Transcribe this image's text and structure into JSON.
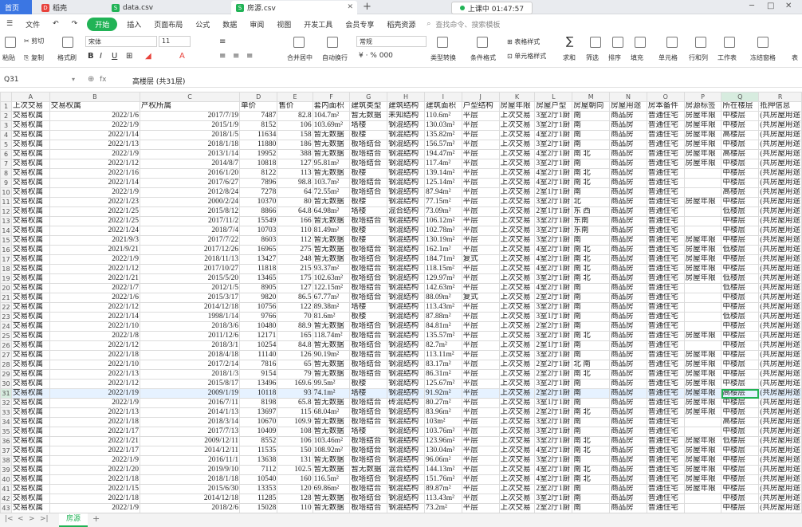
{
  "tabs": [
    {
      "label": "首页",
      "icon": "home-icon"
    },
    {
      "label": "稻壳",
      "icon": "docer-icon"
    },
    {
      "label": "data.csv",
      "icon": "spreadsheet-icon"
    },
    {
      "label": "房源.csv",
      "icon": "spreadsheet-icon"
    }
  ],
  "recording": "上课中 01:47:57",
  "menu": {
    "file": "文件",
    "items": [
      "开始",
      "插入",
      "页面布局",
      "公式",
      "数据",
      "审阅",
      "视图",
      "开发工具",
      "会员专享",
      "稻壳资源"
    ],
    "search": "查找命令、搜索模板"
  },
  "ribbon": {
    "paste": "粘贴",
    "cut": "剪切",
    "copy": "复制",
    "format_painter": "格式刷",
    "font": "宋体",
    "font_size": "11",
    "merge": "合并居中",
    "wrap": "自动换行",
    "number_format": "常规",
    "type_convert": "类型转换",
    "cond_format": "条件格式",
    "table_style": "表格样式",
    "cell_style": "单元格样式",
    "sum": "求和",
    "filter": "筛选",
    "sort": "排序",
    "fill": "填充",
    "cell": "单元格",
    "rowcol": "行和列",
    "sheet": "工作表",
    "freeze": "冻结窗格",
    "more": "表"
  },
  "formula": {
    "cell_ref": "Q31",
    "fx": "fx",
    "content": "高楼层 (共31层)"
  },
  "colors": {
    "accent": "#21b356",
    "brand": "#3b76e3"
  },
  "grid": {
    "columns": [
      "A",
      "B",
      "C",
      "D",
      "E",
      "F",
      "G",
      "H",
      "I",
      "J",
      "K",
      "L",
      "M",
      "N",
      "O",
      "P",
      "Q",
      "R"
    ],
    "header": [
      "上次交易",
      "交易权属",
      "产权所属",
      "单价",
      "售价",
      "套内面积",
      "建筑类型",
      "建筑结构",
      "建筑面积",
      "户型结构",
      "房屋年限",
      "房屋户型",
      "房屋朝向",
      "房屋用途",
      "房本备件",
      "房源标签",
      "所在楼层",
      "抵押信息"
    ],
    "rows": [
      [
        "交易权属",
        "2022/1/6",
        "2017/7/19",
        "7487",
        "82.8",
        "104.7m²",
        "暂无数据",
        "未知结构",
        "110.6m²",
        "平层",
        "上次交易",
        "3室2厅1厨",
        "南",
        "商品房",
        "普通住宅",
        "房屋年限",
        "中楼层",
        "(共房屋用途"
      ],
      [
        "交易权属",
        "2022/1/9",
        "2015/1/9",
        "8152",
        "106",
        "103.69m²",
        "塔楼",
        "钢混结构",
        "130.03m²",
        "平层",
        "上次交易",
        "3室2厅1厨",
        "南",
        "商品房",
        "普通住宅",
        "房屋年限",
        "中楼层",
        "(共房屋用途"
      ],
      [
        "交易权属",
        "2022/1/14",
        "2018/1/5",
        "11634",
        "158",
        "暂无数据",
        "板楼",
        "钢混结构",
        "135.82m²",
        "平层",
        "上次交易",
        "4室2厅1厨",
        "南",
        "商品房",
        "普通住宅",
        "房屋年限",
        "高楼层",
        "(共房屋用途"
      ],
      [
        "交易权属",
        "2022/1/13",
        "2018/1/18",
        "11880",
        "186",
        "暂无数据",
        "板塔结合",
        "钢混结构",
        "156.57m²",
        "平层",
        "上次交易",
        "3室2厅1厨",
        "南",
        "商品房",
        "普通住宅",
        "房屋年限",
        "中楼层",
        "(共房屋用途"
      ],
      [
        "交易权属",
        "2022/1/9",
        "2013/1/14",
        "19952",
        "388",
        "暂无数据",
        "板塔结合",
        "钢混结构",
        "194.47m²",
        "平层",
        "上次交易",
        "4室2厅1厨",
        "南 北",
        "商品房",
        "普通住宅",
        "房屋年限",
        "高楼层",
        "(共房屋用途"
      ],
      [
        "交易权属",
        "2022/1/12",
        "2014/8/7",
        "10818",
        "127",
        "95.81m²",
        "板塔结合",
        "钢混结构",
        "117.4m²",
        "平层",
        "上次交易",
        "3室2厅1厨",
        "南",
        "商品房",
        "普通住宅",
        "房屋年限",
        "中楼层",
        "(共房屋用途"
      ],
      [
        "交易权属",
        "2022/1/16",
        "2016/1/20",
        "8122",
        "113",
        "暂无数据",
        "板楼",
        "钢混结构",
        "139.14m²",
        "平层",
        "上次交易",
        "4室2厅1厨",
        "南 北",
        "商品房",
        "普通住宅",
        "",
        "中楼层",
        "(共房屋用途"
      ],
      [
        "交易权属",
        "2022/1/14",
        "2017/6/27",
        "7896",
        "98.8",
        "103.7m²",
        "板塔结合",
        "钢混结构",
        "125.14m²",
        "平层",
        "上次交易",
        "4室2厅1厨",
        "南 北",
        "商品房",
        "普通住宅",
        "",
        "中楼层",
        "(共房屋用途"
      ],
      [
        "交易权属",
        "2022/1/9",
        "2012/8/24",
        "7278",
        "64",
        "72.55m²",
        "板塔结合",
        "钢混结构",
        "87.94m²",
        "平层",
        "上次交易",
        "2室1厅1厨",
        "南",
        "商品房",
        "普通住宅",
        "",
        "高楼层",
        "(共房屋用途"
      ],
      [
        "交易权属",
        "2022/1/23",
        "2000/2/24",
        "10370",
        "80",
        "暂无数据",
        "板楼",
        "钢混结构",
        "77.15m²",
        "平层",
        "上次交易",
        "3室2厅1厨",
        "北",
        "商品房",
        "普通住宅",
        "房屋年限",
        "中楼层",
        "(共房屋用途"
      ],
      [
        "交易权属",
        "2022/1/25",
        "2015/8/12",
        "8866",
        "64.8",
        "64.98m²",
        "塔楼",
        "混合结构",
        "73.09m²",
        "平层",
        "上次交易",
        "2室1厅1厨",
        "东 西",
        "商品房",
        "普通住宅",
        "",
        "低楼层",
        "(共房屋用途"
      ],
      [
        "交易权属",
        "2022/1/25",
        "2017/11/2",
        "15549",
        "166",
        "暂无数据",
        "板塔结合",
        "钢混结构",
        "106.12m²",
        "平层",
        "上次交易",
        "3室2厅1厨",
        "东南",
        "商品房",
        "普通住宅",
        "",
        "中楼层",
        "(共房屋用途"
      ],
      [
        "交易权属",
        "2022/1/24",
        "2018/7/4",
        "10703",
        "110",
        "81.49m²",
        "板楼",
        "钢混结构",
        "102.78m²",
        "平层",
        "上次交易",
        "3室2厅1厨",
        "东南",
        "商品房",
        "普通住宅",
        "",
        "中楼层",
        "(共房屋用途"
      ],
      [
        "交易权属",
        "2021/9/3",
        "2017/7/22",
        "8603",
        "112",
        "暂无数据",
        "板楼",
        "钢混结构",
        "130.19m²",
        "平层",
        "上次交易",
        "3室2厅1厨",
        "南",
        "商品房",
        "普通住宅",
        "房屋年限",
        "中楼层",
        "(共房屋用途"
      ],
      [
        "交易权属",
        "2021/9/21",
        "2017/12/26",
        "16965",
        "275",
        "暂无数据",
        "板塔结合",
        "钢混结构",
        "162.1m²",
        "平层",
        "上次交易",
        "4室2厅1厨",
        "南 北",
        "商品房",
        "普通住宅",
        "房屋年限",
        "低楼层",
        "(共房屋用途"
      ],
      [
        "交易权属",
        "2022/1/9",
        "2018/11/13",
        "13427",
        "248",
        "暂无数据",
        "板塔结合",
        "钢混结构",
        "184.71m²",
        "复式",
        "上次交易",
        "4室2厅1厨",
        "南 北",
        "商品房",
        "普通住宅",
        "房屋年限",
        "中楼层",
        "(共房屋用途"
      ],
      [
        "交易权属",
        "2022/1/12",
        "2017/10/27",
        "11818",
        "215",
        "93.37m²",
        "板塔结合",
        "钢混结构",
        "118.15m²",
        "平层",
        "上次交易",
        "4室2厅1厨",
        "南 北",
        "商品房",
        "普通住宅",
        "房屋年限",
        "中楼层",
        "(共房屋用途"
      ],
      [
        "交易权属",
        "2022/1/21",
        "2015/5/20",
        "13465",
        "175",
        "102.63m²",
        "板塔结合",
        "钢混结构",
        "129.97m²",
        "平层",
        "上次交易",
        "3室2厅1厨",
        "南 北",
        "商品房",
        "普通住宅",
        "房屋年限",
        "低楼层",
        "(共房屋用途"
      ],
      [
        "交易权属",
        "2022/1/7",
        "2012/1/5",
        "8905",
        "127",
        "122.15m²",
        "板塔结合",
        "钢混结构",
        "142.63m²",
        "平层",
        "上次交易",
        "4室2厅1厨",
        "南",
        "商品房",
        "普通住宅",
        "",
        "低楼层",
        "(共房屋用途"
      ],
      [
        "交易权属",
        "2022/1/6",
        "2015/3/17",
        "9820",
        "86.5",
        "67.77m²",
        "板塔结合",
        "钢混结构",
        "88.09m²",
        "复式",
        "上次交易",
        "2室2厅1厨",
        "南",
        "商品房",
        "普通住宅",
        "",
        "中楼层",
        "(共房屋用途"
      ],
      [
        "交易权属",
        "2022/1/12",
        "2014/12/18",
        "10756",
        "122",
        "89.38m²",
        "塔楼",
        "钢混结构",
        "113.43m²",
        "平层",
        "上次交易",
        "3室2厅1厨",
        "南",
        "商品房",
        "普通住宅",
        "",
        "中楼层",
        "(共房屋用途"
      ],
      [
        "交易权属",
        "2022/1/14",
        "1998/1/14",
        "9766",
        "70",
        "81.6m²",
        "板楼",
        "钢混结构",
        "87.88m²",
        "平层",
        "上次交易",
        "3室1厅1厨",
        "南",
        "商品房",
        "普通住宅",
        "",
        "低楼层",
        "(共房屋用途"
      ],
      [
        "交易权属",
        "2022/1/10",
        "2018/3/6",
        "10480",
        "88.9",
        "暂无数据",
        "板塔结合",
        "钢混结构",
        "84.81m²",
        "平层",
        "上次交易",
        "2室2厅1厨",
        "南",
        "商品房",
        "普通住宅",
        "",
        "中楼层",
        "(共房屋用途"
      ],
      [
        "交易权属",
        "2022/1/8",
        "2011/12/6",
        "12171",
        "165",
        "118.74m²",
        "板塔结合",
        "钢混结构",
        "135.57m²",
        "平层",
        "上次交易",
        "3室2厅1厨",
        "南 北",
        "商品房",
        "普通住宅",
        "房屋年限",
        "中楼层",
        "(共房屋用途"
      ],
      [
        "交易权属",
        "2022/1/12",
        "2018/3/1",
        "10254",
        "84.8",
        "暂无数据",
        "板塔结合",
        "钢混结构",
        "82.7m²",
        "平层",
        "上次交易",
        "2室1厅1厨",
        "南",
        "商品房",
        "普通住宅",
        "",
        "中楼层",
        "(共房屋用途"
      ],
      [
        "交易权属",
        "2022/1/18",
        "2018/4/18",
        "11140",
        "126",
        "90.19m²",
        "板塔结合",
        "钢混结构",
        "113.11m²",
        "平层",
        "上次交易",
        "3室2厅1厨",
        "南",
        "商品房",
        "普通住宅",
        "房屋年限",
        "中楼层",
        "(共房屋用途"
      ],
      [
        "交易权属",
        "2022/1/10",
        "2017/2/14",
        "7816",
        "65",
        "暂无数据",
        "板塔结合",
        "钢混结构",
        "83.17m²",
        "平层",
        "上次交易",
        "2室2厅1厨",
        "北 南",
        "商品房",
        "普通住宅",
        "房屋年限",
        "中楼层",
        "(共房屋用途"
      ],
      [
        "交易权属",
        "2022/1/13",
        "2018/1/3",
        "9154",
        "79",
        "暂无数据",
        "板塔结合",
        "钢混结构",
        "86.31m²",
        "平层",
        "上次交易",
        "2室2厅1厨",
        "南 北",
        "商品房",
        "普通住宅",
        "房屋年限",
        "中楼层",
        "(共房屋用途"
      ],
      [
        "交易权属",
        "2022/1/12",
        "2015/8/17",
        "13496",
        "169.6",
        "99.5m²",
        "板楼",
        "钢混结构",
        "125.67m²",
        "平层",
        "上次交易",
        "3室2厅1厨",
        "南",
        "商品房",
        "普通住宅",
        "房屋年限",
        "中楼层",
        "(共房屋用途"
      ],
      [
        "交易权属",
        "2022/1/19",
        "2009/1/19",
        "10118",
        "93",
        "74.1m²",
        "塔楼",
        "钢混结构",
        "91.92m²",
        "平层",
        "上次交易",
        "2室2厅1厨",
        "南",
        "商品房",
        "普通住宅",
        "房屋年限",
        "高楼层",
        "(共房屋用途"
      ],
      [
        "交易权属",
        "2022/1/9",
        "2016/7/11",
        "8198",
        "65.8",
        "暂无数据",
        "板塔结合",
        "砖混结构",
        "80.27m²",
        "平层",
        "上次交易",
        "3室1厅1厨",
        "南",
        "商品房",
        "普通住宅",
        "房屋年限",
        "中楼层",
        "(共房屋用途"
      ],
      [
        "交易权属",
        "2022/1/13",
        "2014/1/13",
        "13697",
        "115",
        "68.04m²",
        "板塔结合",
        "钢混结构",
        "83.96m²",
        "平层",
        "上次交易",
        "2室2厅1厨",
        "南 北",
        "商品房",
        "普通住宅",
        "房屋年限",
        "中楼层",
        "(共房屋用途"
      ],
      [
        "交易权属",
        "2022/1/18",
        "2018/3/14",
        "10670",
        "109.9",
        "暂无数据",
        "板塔结合",
        "钢混结构",
        "103m²",
        "平层",
        "上次交易",
        "3室2厅1厨",
        "南",
        "商品房",
        "普通住宅",
        "",
        "高楼层",
        "(共房屋用途"
      ],
      [
        "交易权属",
        "2022/1/17",
        "2017/7/13",
        "10409",
        "108",
        "暂无数据",
        "塔楼",
        "钢混结构",
        "103.76m²",
        "平层",
        "上次交易",
        "3室2厅1厨",
        "南",
        "商品房",
        "普通住宅",
        "",
        "中楼层",
        "(共房屋用途"
      ],
      [
        "交易权属",
        "2022/1/21",
        "2009/12/11",
        "8552",
        "106",
        "103.46m²",
        "板塔结合",
        "钢混结构",
        "123.96m²",
        "平层",
        "上次交易",
        "3室2厅1厨",
        "南 北",
        "商品房",
        "普通住宅",
        "房屋年限",
        "低楼层",
        "(共房屋用途"
      ],
      [
        "交易权属",
        "2022/1/17",
        "2014/12/11",
        "11535",
        "150",
        "108.92m²",
        "板塔结合",
        "钢混结构",
        "130.04m²",
        "平层",
        "上次交易",
        "4室2厅1厨",
        "南 北",
        "商品房",
        "普通住宅",
        "房屋年限",
        "中楼层",
        "(共房屋用途"
      ],
      [
        "交易权属",
        "2022/1/9",
        "2016/11/1",
        "13638",
        "131",
        "暂无数据",
        "板塔结合",
        "钢混结构",
        "96.06m²",
        "平层",
        "上次交易",
        "3室2厅1厨",
        "南",
        "商品房",
        "普通住宅",
        "房屋年限",
        "中楼层",
        "(共房屋用途"
      ],
      [
        "交易权属",
        "2022/1/20",
        "2019/9/10",
        "7112",
        "102.5",
        "暂无数据",
        "暂无数据",
        "混合结构",
        "144.13m²",
        "平层",
        "上次交易",
        "4室2厅1厨",
        "南 北",
        "商品房",
        "普通住宅",
        "房屋年限",
        "中楼层",
        "(共房屋用途"
      ],
      [
        "交易权属",
        "2022/1/18",
        "2018/1/18",
        "10540",
        "160",
        "116.5m²",
        "板塔结合",
        "钢混结构",
        "151.76m²",
        "平层",
        "上次交易",
        "4室2厅1厨",
        "南 北",
        "商品房",
        "普通住宅",
        "房屋年限",
        "中楼层",
        "(共房屋用途"
      ],
      [
        "交易权属",
        "2022/1/15",
        "2015/6/30",
        "13353",
        "120",
        "69.86m²",
        "板塔结合",
        "钢混结构",
        "89.87m²",
        "平层",
        "上次交易",
        "2室2厅1厨",
        "南",
        "商品房",
        "普通住宅",
        "房屋年限",
        "中楼层",
        "(共房屋用途"
      ],
      [
        "交易权属",
        "2022/1/18",
        "2014/12/18",
        "11285",
        "128",
        "暂无数据",
        "板塔结合",
        "钢混结构",
        "113.43m²",
        "平层",
        "上次交易",
        "3室2厅1厨",
        "南",
        "商品房",
        "普通住宅",
        "",
        "中楼层",
        "(共房屋用途"
      ],
      [
        "交易权属",
        "2022/1/9",
        "2018/2/6",
        "15028",
        "110",
        "暂无数据",
        "板塔结合",
        "钢混结构",
        "73.2m²",
        "平层",
        "上次交易",
        "2室2厅1厨",
        "南",
        "商品房",
        "普通住宅",
        "",
        "中楼层",
        "(共房屋用途"
      ],
      [
        "交易权属",
        "2022/1/11",
        "2018/3/1",
        "10380",
        "85",
        "暂无数据",
        "板塔结合",
        "钢混结构",
        "81.89m²",
        "平层",
        "上次交易",
        "2室2厅1厨",
        "南",
        "商品房",
        "普通住宅",
        "",
        "中楼层",
        "(共房屋用途"
      ]
    ],
    "selected_row": 31,
    "selected_col": "Q"
  },
  "sheets": [
    "房源"
  ]
}
